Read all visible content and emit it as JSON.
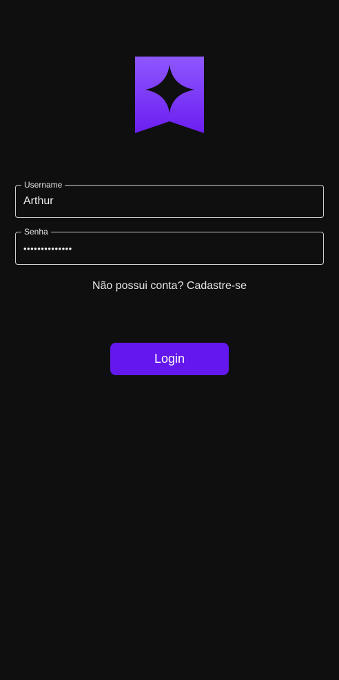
{
  "logo": {
    "icon": "bookmark-star-icon",
    "colors": {
      "gradient_top": "#8e57ff",
      "gradient_bottom": "#6c1ef0",
      "star": "#0f0f0f"
    }
  },
  "form": {
    "username": {
      "label": "Username",
      "value": "Arthur"
    },
    "password": {
      "label": "Senha",
      "value": "••••••••••••••"
    },
    "signup_link": "Não possui conta? Cadastre-se",
    "login_label": "Login"
  },
  "colors": {
    "background": "#0f0f0f",
    "accent": "#6418ee",
    "field_border": "#cfcfcf"
  }
}
